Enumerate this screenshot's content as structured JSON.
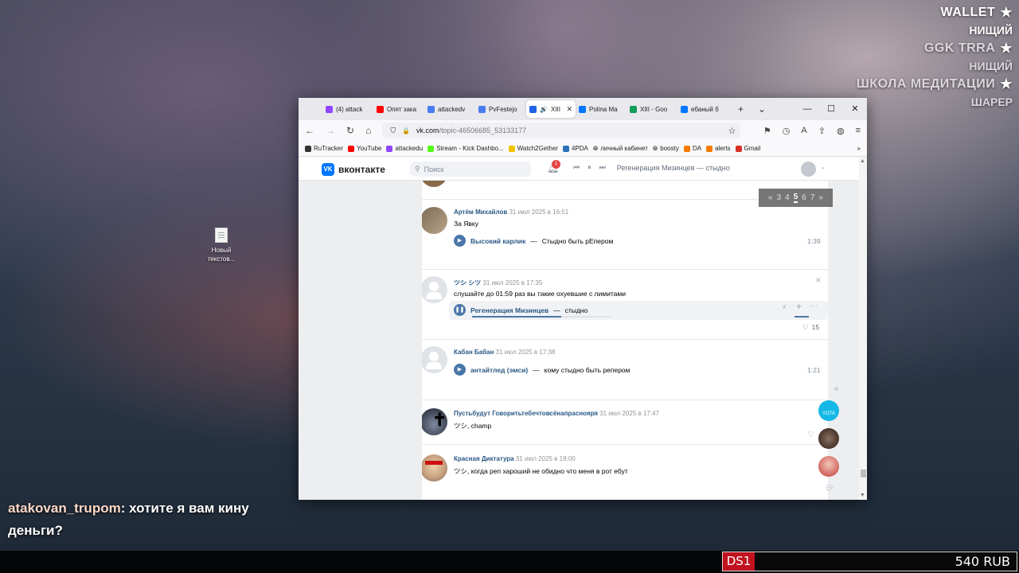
{
  "overlay": {
    "lines": [
      {
        "text": "WALLET",
        "style": "big",
        "star": true
      },
      {
        "text": "НИЩИЙ",
        "style": "small"
      },
      {
        "text": "GGK TRRA",
        "style": "big-muted",
        "star": true
      },
      {
        "text": "НИЩИЙ",
        "style": "small-muted"
      },
      {
        "text": "ШКОЛА МЕДИТАЦИИ",
        "style": "big-muted",
        "star": true
      },
      {
        "text": "ШАРЕР",
        "style": "small-muted"
      }
    ]
  },
  "desktop": {
    "icon_label": "Новый текстов..."
  },
  "chat": {
    "user": "atakovan_trupom",
    "message": "хотите я вам кину деньги?"
  },
  "donation_bar": {
    "tag": "DS1",
    "amount": "540 RUB"
  },
  "browser": {
    "tabs": [
      {
        "label": "(4) attack",
        "icon": "twitch-icon",
        "color": "#9146ff"
      },
      {
        "label": "Опят зака",
        "icon": "youtube-icon",
        "color": "#ff0000"
      },
      {
        "label": "attackedv",
        "icon": "doc-icon",
        "color": "#4a7cf0"
      },
      {
        "label": "PvFestejo",
        "icon": "doc-icon",
        "color": "#4a7cf0"
      },
      {
        "label": "XIII",
        "icon": "play-icon",
        "color": "#1e63e9",
        "active": true
      },
      {
        "label": "Polina Ma",
        "icon": "vk-icon",
        "color": "#0077ff"
      },
      {
        "label": "XIII - Goo",
        "icon": "sheets-icon",
        "color": "#0f9d58"
      },
      {
        "label": "ебаный б",
        "icon": "vk-icon",
        "color": "#0077ff"
      }
    ],
    "url": {
      "host": "vk.com",
      "path": "/topic-46506685_53133177"
    },
    "bookmarks": [
      {
        "label": "RuTracker",
        "icon": "rutracker-icon",
        "color": "#333"
      },
      {
        "label": "YouTube",
        "icon": "youtube-icon",
        "color": "#ff0000"
      },
      {
        "label": "attackedu",
        "icon": "twitch-icon",
        "color": "#9146ff"
      },
      {
        "label": "Stream - Kick Dashbo...",
        "icon": "kick-icon",
        "color": "#53fc18"
      },
      {
        "label": "Watch2Gether",
        "icon": "w2g-icon",
        "color": "#f2c200"
      },
      {
        "label": "4PDA",
        "icon": "fourpda-icon",
        "color": "#2a73b8"
      },
      {
        "label": "личный кабинет",
        "icon": "globe-icon",
        "color": "#666"
      },
      {
        "label": "boosty",
        "icon": "globe-icon",
        "color": "#666"
      },
      {
        "label": "DA",
        "icon": "da-icon",
        "color": "#f57c00"
      },
      {
        "label": "alerts",
        "icon": "da-icon",
        "color": "#f57c00"
      },
      {
        "label": "Gmail",
        "icon": "gmail-icon",
        "color": "#d93025"
      }
    ]
  },
  "vk": {
    "logo_text": "вконтакте",
    "search_placeholder": "Поиск",
    "notif_count": "1",
    "now_playing": "Регенерация Мизинцев — стыдно",
    "pager": {
      "prev": "«",
      "pages": [
        "3",
        "4",
        "5",
        "6",
        "7"
      ],
      "current": "5",
      "next": "»"
    },
    "posts": [
      {
        "name": "Артём Михайлов",
        "date": "31 июл 2025 в 16:51",
        "text": "За Явку",
        "audio": {
          "artist": "Высокий карлик",
          "title": "Стыдно быть рЕпером",
          "duration": "1:39"
        }
      },
      {
        "name": "ツシ シツ",
        "date": "31 июл 2025 в 17:35",
        "text": "слушайте до 01:59 раз вы такие охуевшие с лимитами",
        "audio": {
          "artist": "Регенерация Мизинцев",
          "title": "стыдно"
        },
        "likes": "15"
      },
      {
        "name": "Кабан Бабан",
        "date": "31 июл 2025 в 17:38",
        "audio": {
          "artist": "антайтлед (эмси)",
          "title": "кому стыдно быть репером",
          "duration": "1:21"
        }
      },
      {
        "name": "Пустьбудут Говоритьтебечтовсёнапраснояря",
        "date": "31 июл 2025 в 17:47",
        "text": "ツシ, champ"
      },
      {
        "name": "Красная Диктатура",
        "date": "31 июл 2025 в 19:00",
        "text": "ツシ, когда реп хароший не обидно что меня в рот ебут"
      }
    ],
    "dock_badge": "YOTA"
  }
}
